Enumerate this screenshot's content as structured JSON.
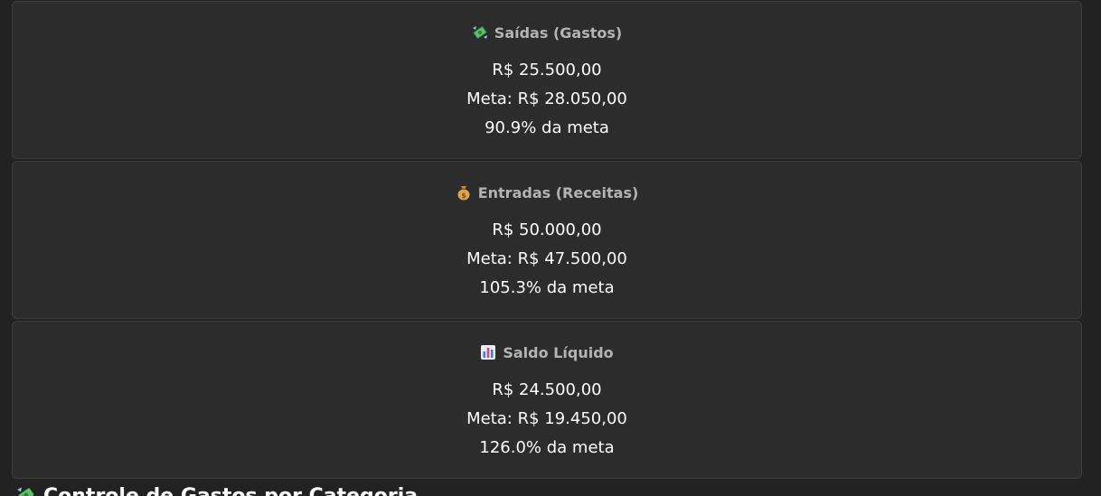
{
  "cards": [
    {
      "icon": "money-with-wings-icon",
      "title": "Saídas (Gastos)",
      "value": "R$ 25.500,00",
      "goal": "Meta: R$ 28.050,00",
      "percent": "90.9% da meta"
    },
    {
      "icon": "money-bag-icon",
      "title": "Entradas (Receitas)",
      "value": "R$ 50.000,00",
      "goal": "Meta: R$ 47.500,00",
      "percent": "105.3% da meta"
    },
    {
      "icon": "bar-chart-icon",
      "title": "Saldo Líquido",
      "value": "R$ 24.500,00",
      "goal": "Meta: R$ 19.450,00",
      "percent": "126.0% da meta"
    }
  ],
  "section": {
    "icon": "money-with-wings-icon",
    "heading": "Controle de Gastos por Categoria"
  },
  "colors": {
    "background": "#222222",
    "card_background": "#2c2c2c",
    "card_border": "#3c3c3c",
    "title_text": "#b4b4b4",
    "value_text": "#ffffff"
  }
}
